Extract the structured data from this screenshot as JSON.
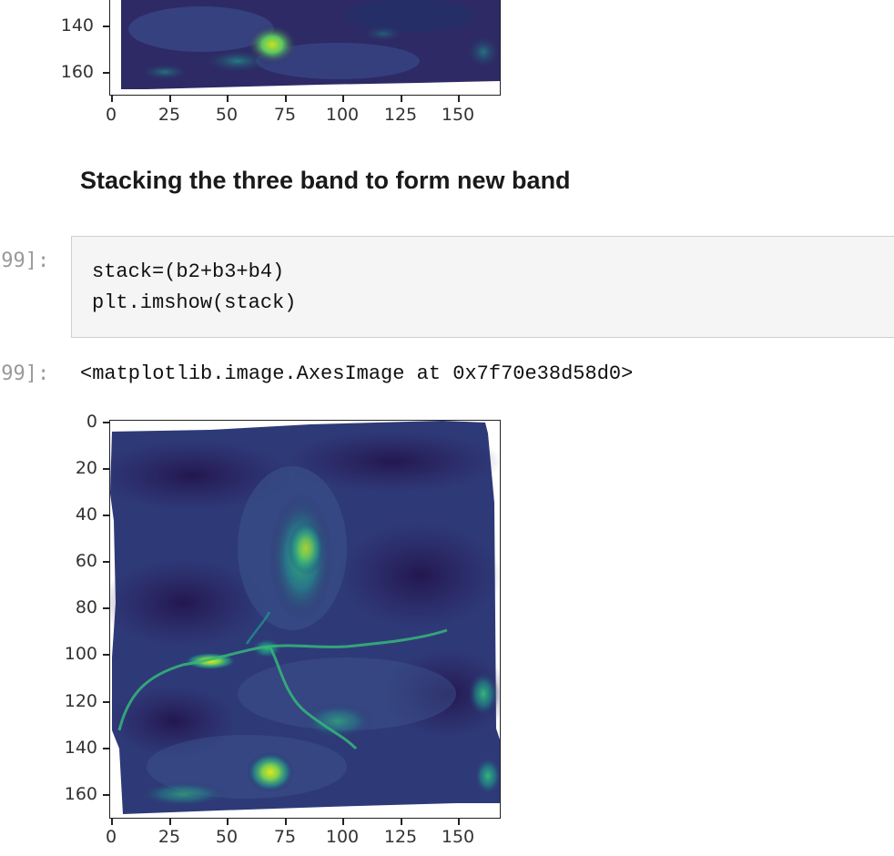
{
  "top_plot": {
    "y_ticks": [
      "140",
      "160"
    ],
    "x_ticks": [
      "0",
      "25",
      "50",
      "75",
      "100",
      "125",
      "150"
    ]
  },
  "markdown": {
    "heading": "Stacking the three band to form new band"
  },
  "input_cell": {
    "prompt": "[99]:",
    "lines": [
      "stack=(b2+b3+b4)",
      "plt.imshow(stack)"
    ]
  },
  "output_cell": {
    "prompt": "[99]:",
    "text": "<matplotlib.image.AxesImage at 0x7f70e38d58d0>"
  },
  "bottom_plot": {
    "y_ticks": [
      "0",
      "20",
      "40",
      "60",
      "80",
      "100",
      "120",
      "140",
      "160"
    ],
    "x_ticks": [
      "0",
      "25",
      "50",
      "75",
      "100",
      "125",
      "150"
    ]
  },
  "colors": {
    "image_dark": "#2b1f5c",
    "image_mid": "#3b4f8c",
    "image_teal": "#21918c",
    "image_bright": "#c8e020"
  }
}
